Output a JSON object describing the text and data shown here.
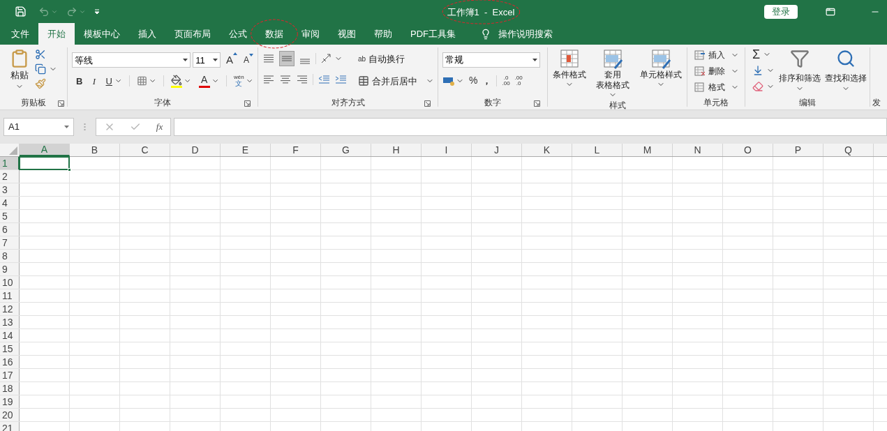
{
  "title_bar": {
    "title": "工作簿1  -  Excel",
    "circled": true,
    "sign_in": "登录"
  },
  "tabs": [
    {
      "label": "文件",
      "selected": false,
      "circled": false
    },
    {
      "label": "开始",
      "selected": true,
      "circled": false
    },
    {
      "label": "模板中心",
      "selected": false,
      "circled": false
    },
    {
      "label": "插入",
      "selected": false,
      "circled": false
    },
    {
      "label": "页面布局",
      "selected": false,
      "circled": false
    },
    {
      "label": "公式",
      "selected": false,
      "circled": false
    },
    {
      "label": "数据",
      "selected": false,
      "circled": true
    },
    {
      "label": "审阅",
      "selected": false,
      "circled": false
    },
    {
      "label": "视图",
      "selected": false,
      "circled": false
    },
    {
      "label": "帮助",
      "selected": false,
      "circled": false
    },
    {
      "label": "PDF工具集",
      "selected": false,
      "circled": false
    }
  ],
  "tell_me": "操作说明搜索",
  "ribbon": {
    "clipboard": {
      "label": "剪贴板",
      "paste": "粘贴"
    },
    "font": {
      "label": "字体",
      "font_name": "等线",
      "font_size": "11",
      "grow": "A",
      "shrink": "A",
      "bold": "B",
      "italic": "I",
      "underline": "U",
      "font_color": "A",
      "phonetic_top": "wén",
      "phonetic_bottom": "文"
    },
    "alignment": {
      "label": "对齐方式",
      "wrap_icon": "ab",
      "wrap": "自动换行",
      "merge": "合并后居中",
      "center_selected": true
    },
    "number": {
      "label": "数字",
      "format": "常规",
      "percent": "%",
      "comma": "，",
      "increase_decimal": [
        ".0",
        ".00"
      ],
      "decrease_decimal": [
        ".00",
        ".0"
      ]
    },
    "styles": {
      "label": "样式",
      "buttons": [
        {
          "lines": [
            "条件格式"
          ]
        },
        {
          "lines": [
            "套用",
            "表格格式"
          ]
        },
        {
          "lines": [
            "单元格样式"
          ]
        }
      ]
    },
    "cells": {
      "label": "单元格",
      "buttons": [
        "插入",
        "删除",
        "格式"
      ]
    },
    "editing": {
      "label": "编辑",
      "sum": "Σ",
      "sort": "排序和筛选",
      "find": "查找和选择"
    },
    "partial_group_label": "发"
  },
  "formula_bar": {
    "name_box": "A1",
    "fx": "fx"
  },
  "grid": {
    "columns": [
      {
        "label": "A",
        "selected": true
      },
      {
        "label": "B",
        "selected": false
      },
      {
        "label": "C",
        "selected": false
      },
      {
        "label": "D",
        "selected": false
      },
      {
        "label": "E",
        "selected": false
      },
      {
        "label": "F",
        "selected": false
      },
      {
        "label": "G",
        "selected": false
      },
      {
        "label": "H",
        "selected": false
      },
      {
        "label": "I",
        "selected": false
      },
      {
        "label": "J",
        "selected": false
      },
      {
        "label": "K",
        "selected": false
      },
      {
        "label": "L",
        "selected": false
      },
      {
        "label": "M",
        "selected": false
      },
      {
        "label": "N",
        "selected": false
      },
      {
        "label": "O",
        "selected": false
      },
      {
        "label": "P",
        "selected": false
      },
      {
        "label": "Q",
        "selected": false
      }
    ],
    "rows": [
      {
        "label": "1",
        "selected": true
      },
      {
        "label": "2",
        "selected": false
      },
      {
        "label": "3",
        "selected": false
      },
      {
        "label": "4",
        "selected": false
      },
      {
        "label": "5",
        "selected": false
      },
      {
        "label": "6",
        "selected": false
      },
      {
        "label": "7",
        "selected": false
      },
      {
        "label": "8",
        "selected": false
      },
      {
        "label": "9",
        "selected": false
      },
      {
        "label": "10",
        "selected": false
      },
      {
        "label": "11",
        "selected": false
      },
      {
        "label": "12",
        "selected": false
      },
      {
        "label": "13",
        "selected": false
      },
      {
        "label": "14",
        "selected": false
      },
      {
        "label": "15",
        "selected": false
      },
      {
        "label": "16",
        "selected": false
      },
      {
        "label": "17",
        "selected": false
      },
      {
        "label": "18",
        "selected": false
      },
      {
        "label": "19",
        "selected": false
      },
      {
        "label": "20",
        "selected": false
      },
      {
        "label": "21",
        "selected": false
      }
    ]
  }
}
